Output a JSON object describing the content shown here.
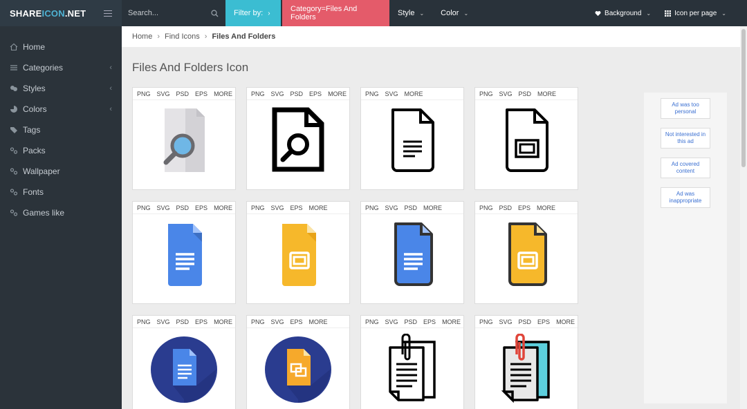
{
  "brand": {
    "logo_left": "SHARE",
    "logo_mid": "ICON",
    "logo_right": ".NET"
  },
  "sidebar": {
    "items": [
      {
        "label": "Home",
        "icon": "home-icon",
        "chevron": ""
      },
      {
        "label": "Categories",
        "icon": "list-icon",
        "chevron": "‹"
      },
      {
        "label": "Styles",
        "icon": "paint-icon",
        "chevron": "‹"
      },
      {
        "label": "Colors",
        "icon": "pie-icon",
        "chevron": "‹"
      },
      {
        "label": "Tags",
        "icon": "tags-icon",
        "chevron": ""
      },
      {
        "label": "Packs",
        "icon": "link-icon",
        "chevron": ""
      },
      {
        "label": "Wallpaper",
        "icon": "link-icon",
        "chevron": ""
      },
      {
        "label": "Fonts",
        "icon": "link-icon",
        "chevron": ""
      },
      {
        "label": "Games like",
        "icon": "link-icon",
        "chevron": ""
      }
    ]
  },
  "topbar": {
    "search_placeholder": "Search...",
    "filter_label": "Filter by:",
    "filter_arrow": "›",
    "category_label": "Category=Files And Folders",
    "style_label": "Style",
    "color_label": "Color",
    "background_label": "Background",
    "per_page_label": "Icon per page",
    "caret": "⌄"
  },
  "breadcrumb": {
    "home": "Home",
    "find": "Find Icons",
    "current": "Files And Folders",
    "sep": "›"
  },
  "page": {
    "title": "Files And Folders Icon"
  },
  "cards": [
    {
      "formats": [
        "PNG",
        "SVG",
        "PSD",
        "EPS",
        "MORE"
      ],
      "icon": "file-search-flat-icon"
    },
    {
      "formats": [
        "PNG",
        "SVG",
        "PSD",
        "EPS",
        "MORE"
      ],
      "icon": "file-search-outline-icon"
    },
    {
      "formats": [
        "PNG",
        "SVG",
        "MORE"
      ],
      "icon": "document-outline-icon"
    },
    {
      "formats": [
        "PNG",
        "SVG",
        "PSD",
        "MORE"
      ],
      "icon": "slides-outline-icon"
    },
    {
      "formats": [
        "PNG",
        "SVG",
        "PSD",
        "EPS",
        "MORE"
      ],
      "icon": "google-docs-icon"
    },
    {
      "formats": [
        "PNG",
        "SVG",
        "EPS",
        "MORE"
      ],
      "icon": "google-slides-icon"
    },
    {
      "formats": [
        "PNG",
        "SVG",
        "PSD",
        "MORE"
      ],
      "icon": "docs-outlined-icon"
    },
    {
      "formats": [
        "PNG",
        "PSD",
        "EPS",
        "MORE"
      ],
      "icon": "slides-outlined-icon"
    },
    {
      "formats": [
        "PNG",
        "SVG",
        "PSD",
        "EPS",
        "MORE"
      ],
      "icon": "docs-circle-icon"
    },
    {
      "formats": [
        "PNG",
        "SVG",
        "EPS",
        "MORE"
      ],
      "icon": "slides-circle-icon"
    },
    {
      "formats": [
        "PNG",
        "SVG",
        "PSD",
        "EPS",
        "MORE"
      ],
      "icon": "clipboard-papers-outline-icon"
    },
    {
      "formats": [
        "PNG",
        "SVG",
        "PSD",
        "EPS",
        "MORE"
      ],
      "icon": "clipboard-papers-color-icon"
    }
  ],
  "ads": [
    "Ad was too personal",
    "Not interested in this ad",
    "Ad covered content",
    "Ad was inappropriate"
  ],
  "colors": {
    "filter_accent": "#3bbdd2",
    "category_accent": "#e45b6a",
    "docs_blue": "#4a86e8",
    "slides_yellow": "#f6b82b"
  }
}
